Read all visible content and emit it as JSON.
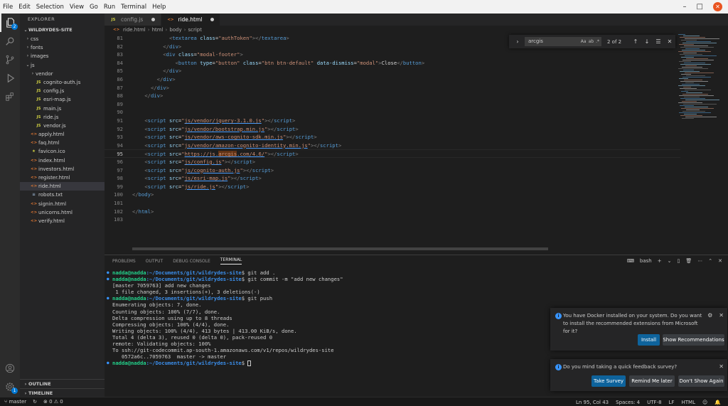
{
  "menu": [
    "File",
    "Edit",
    "Selection",
    "View",
    "Go",
    "Run",
    "Terminal",
    "Help"
  ],
  "window_controls": {
    "minimize": "–",
    "maximize": "□",
    "close": "✕"
  },
  "activity": {
    "explorer_badge": "2",
    "accounts": "account",
    "settings_badge": "1"
  },
  "sidebar": {
    "title": "EXPLORER",
    "root": "WILDRYDES-SITE",
    "items": [
      {
        "label": "css",
        "type": "folder",
        "indent": 1,
        "chevron": "›"
      },
      {
        "label": "fonts",
        "type": "folder",
        "indent": 1,
        "chevron": "›"
      },
      {
        "label": "images",
        "type": "folder",
        "indent": 1,
        "chevron": "›"
      },
      {
        "label": "js",
        "type": "folder",
        "indent": 1,
        "chevron": "⌄"
      },
      {
        "label": "vendor",
        "type": "folder",
        "indent": 2,
        "chevron": "›"
      },
      {
        "label": "cognito-auth.js",
        "type": "js",
        "indent": 2
      },
      {
        "label": "config.js",
        "type": "js",
        "indent": 2
      },
      {
        "label": "esri-map.js",
        "type": "js",
        "indent": 2
      },
      {
        "label": "main.js",
        "type": "js",
        "indent": 2
      },
      {
        "label": "ride.js",
        "type": "js",
        "indent": 2
      },
      {
        "label": "vendor.js",
        "type": "js",
        "indent": 2
      },
      {
        "label": "apply.html",
        "type": "html",
        "indent": 1
      },
      {
        "label": "faq.html",
        "type": "html",
        "indent": 1
      },
      {
        "label": "favicon.ico",
        "type": "ico",
        "indent": 1
      },
      {
        "label": "index.html",
        "type": "html",
        "indent": 1
      },
      {
        "label": "investors.html",
        "type": "html",
        "indent": 1
      },
      {
        "label": "register.html",
        "type": "html",
        "indent": 1
      },
      {
        "label": "ride.html",
        "type": "html",
        "indent": 1,
        "selected": true
      },
      {
        "label": "robots.txt",
        "type": "txt",
        "indent": 1
      },
      {
        "label": "signin.html",
        "type": "html",
        "indent": 1
      },
      {
        "label": "unicorns.html",
        "type": "html",
        "indent": 1
      },
      {
        "label": "verify.html",
        "type": "html",
        "indent": 1
      }
    ],
    "outline": "OUTLINE",
    "timeline": "TIMELINE"
  },
  "tabs": [
    {
      "label": "config.js",
      "icon": "JS",
      "active": false
    },
    {
      "label": "ride.html",
      "icon": "<>",
      "active": true
    }
  ],
  "breadcrumb": [
    "ride.html",
    "html",
    "body",
    "script"
  ],
  "editor": {
    "current_line": 95,
    "lines": [
      {
        "n": "81",
        "html": "            <span class=\"p\">&lt;</span><span class=\"t\">textarea</span> <span class=\"a\">class</span>=<span class=\"s\">\"authToken\"</span><span class=\"p\">&gt;&lt;/</span><span class=\"t\">textarea</span><span class=\"p\">&gt;</span>"
      },
      {
        "n": "82",
        "html": "          <span class=\"p\">&lt;/</span><span class=\"t\">div</span><span class=\"p\">&gt;</span>"
      },
      {
        "n": "83",
        "html": "          <span class=\"p\">&lt;</span><span class=\"t\">div</span> <span class=\"a\">class</span>=<span class=\"s\">\"modal-footer\"</span><span class=\"p\">&gt;</span>"
      },
      {
        "n": "84",
        "html": "              <span class=\"p\">&lt;</span><span class=\"t\">button</span> <span class=\"a\">type</span>=<span class=\"s\">\"button\"</span> <span class=\"a\">class</span>=<span class=\"s\">\"btn btn-default\"</span> <span class=\"a\">data-dismiss</span>=<span class=\"s\">\"modal\"</span><span class=\"p\">&gt;</span><span class=\"x\">Close</span><span class=\"p\">&lt;/</span><span class=\"t\">button</span><span class=\"p\">&gt;</span>"
      },
      {
        "n": "85",
        "html": "          <span class=\"p\">&lt;/</span><span class=\"t\">div</span><span class=\"p\">&gt;</span>"
      },
      {
        "n": "86",
        "html": "        <span class=\"p\">&lt;/</span><span class=\"t\">div</span><span class=\"p\">&gt;</span>"
      },
      {
        "n": "87",
        "html": "      <span class=\"p\">&lt;/</span><span class=\"t\">div</span><span class=\"p\">&gt;</span>"
      },
      {
        "n": "88",
        "html": "    <span class=\"p\">&lt;/</span><span class=\"t\">div</span><span class=\"p\">&gt;</span>"
      },
      {
        "n": "89",
        "html": ""
      },
      {
        "n": "90",
        "html": ""
      },
      {
        "n": "91",
        "html": "    <span class=\"p\">&lt;</span><span class=\"t\">script</span> <span class=\"a\">src</span>=<span class=\"s\">\"<span class=\"u\">js/vendor/jquery-3.1.0.js</span>\"</span><span class=\"p\">&gt;&lt;/</span><span class=\"t\">script</span><span class=\"p\">&gt;</span>"
      },
      {
        "n": "92",
        "html": "    <span class=\"p\">&lt;</span><span class=\"t\">script</span> <span class=\"a\">src</span>=<span class=\"s\">\"<span class=\"u\">js/vendor/bootstrap.min.js</span>\"</span><span class=\"p\">&gt;&lt;/</span><span class=\"t\">script</span><span class=\"p\">&gt;</span>"
      },
      {
        "n": "93",
        "html": "    <span class=\"p\">&lt;</span><span class=\"t\">script</span> <span class=\"a\">src</span>=<span class=\"s\">\"<span class=\"u\">js/vendor/aws-cognito-sdk.min.js</span>\"</span><span class=\"p\">&gt;&lt;/</span><span class=\"t\">script</span><span class=\"p\">&gt;</span>"
      },
      {
        "n": "94",
        "html": "    <span class=\"p\">&lt;</span><span class=\"t\">script</span> <span class=\"a\">src</span>=<span class=\"s\">\"<span class=\"u\">js/vendor/amazon-cognito-identity.min.js</span>\"</span><span class=\"p\">&gt;&lt;/</span><span class=\"t\">script</span><span class=\"p\">&gt;</span>"
      },
      {
        "n": "95",
        "html": "    <span class=\"p\">&lt;</span><span class=\"t\">script</span> <span class=\"a\">src</span>=<span class=\"s\">\"<span class=\"u\">https://js.<span class=\"hl\">arcgis</span>.com/4.6/</span>\"</span><span class=\"p\">&gt;&lt;/</span><span class=\"t\">script</span><span class=\"p\">&gt;</span>"
      },
      {
        "n": "96",
        "html": "    <span class=\"p\">&lt;</span><span class=\"t\">script</span> <span class=\"a\">src</span>=<span class=\"s\">\"<span class=\"u\">js/config.js</span>\"</span><span class=\"p\">&gt;&lt;/</span><span class=\"t\">script</span><span class=\"p\">&gt;</span>"
      },
      {
        "n": "97",
        "html": "    <span class=\"p\">&lt;</span><span class=\"t\">script</span> <span class=\"a\">src</span>=<span class=\"s\">\"<span class=\"u\">js/cognito-auth.js</span>\"</span><span class=\"p\">&gt;&lt;/</span><span class=\"t\">script</span><span class=\"p\">&gt;</span>"
      },
      {
        "n": "98",
        "html": "    <span class=\"p\">&lt;</span><span class=\"t\">script</span> <span class=\"a\">src</span>=<span class=\"s\">\"<span class=\"u\">js/esri-map.js</span>\"</span><span class=\"p\">&gt;&lt;/</span><span class=\"t\">script</span><span class=\"p\">&gt;</span>"
      },
      {
        "n": "99",
        "html": "    <span class=\"p\">&lt;</span><span class=\"t\">script</span> <span class=\"a\">src</span>=<span class=\"s\">\"<span class=\"u\">js/ride.js</span>\"</span><span class=\"p\">&gt;&lt;/</span><span class=\"t\">script</span><span class=\"p\">&gt;</span>"
      },
      {
        "n": "100",
        "html": "<span class=\"p\">&lt;/</span><span class=\"t\">body</span><span class=\"p\">&gt;</span>"
      },
      {
        "n": "101",
        "html": ""
      },
      {
        "n": "102",
        "html": "<span class=\"p\">&lt;/</span><span class=\"t\">html</span><span class=\"p\">&gt;</span>"
      },
      {
        "n": "103",
        "html": ""
      }
    ]
  },
  "find": {
    "value": "arcgis",
    "options": [
      "Aa",
      "ab",
      ".*"
    ],
    "count": "2 of 2",
    "buttons": [
      "↑",
      "↓",
      "☰",
      "✕"
    ]
  },
  "panel": {
    "tabs": [
      "PROBLEMS",
      "OUTPUT",
      "DEBUG CONSOLE",
      "TERMINAL"
    ],
    "active_tab": "TERMINAL",
    "shell": "bash",
    "tools": [
      "+",
      "⌄",
      "▯",
      "🗑",
      "⋯",
      "⌃",
      "✕"
    ],
    "terminal": [
      {
        "bullet": true,
        "user": "nadda@nadda",
        "path": ":~/Documents/git/wildrydes-site",
        "cmd": "$ git add ."
      },
      {
        "bullet": true,
        "user": "nadda@nadda",
        "path": ":~/Documents/git/wildrydes-site",
        "cmd": "$ git commit -m \"add new changes\""
      },
      {
        "text": "[master 7059763] add new changes"
      },
      {
        "text": " 1 file changed, 3 insertions(+), 3 deletions(-)"
      },
      {
        "bullet": true,
        "user": "nadda@nadda",
        "path": ":~/Documents/git/wildrydes-site",
        "cmd": "$ git push"
      },
      {
        "text": "Enumerating objects: 7, done."
      },
      {
        "text": "Counting objects: 100% (7/7), done."
      },
      {
        "text": "Delta compression using up to 8 threads"
      },
      {
        "text": "Compressing objects: 100% (4/4), done."
      },
      {
        "text": "Writing objects: 100% (4/4), 413 bytes | 413.00 KiB/s, done."
      },
      {
        "text": "Total 4 (delta 3), reused 0 (delta 0), pack-reused 0"
      },
      {
        "text": "remote: Validating objects: 100%"
      },
      {
        "text": "To ssh://git-codecommit.ap-south-1.amazonaws.com/v1/repos/wildrydes-site"
      },
      {
        "text": "   0572a6c..7059763  master -> master"
      },
      {
        "bullet": true,
        "user": "nadda@nadda",
        "path": ":~/Documents/git/wildrydes-site",
        "cmd": "$ ",
        "cursor": true
      }
    ]
  },
  "notifications": {
    "docker": {
      "message": "You have Docker installed on your system. Do you want to install the recommended extensions from Microsoft for it?",
      "primary": "Install",
      "secondary": "Show Recommendations"
    },
    "survey": {
      "message": "Do you mind taking a quick feedback survey?",
      "primary": "Take Survey",
      "secondary": "Remind Me later",
      "tertiary": "Don't Show Again"
    }
  },
  "status": {
    "branch": "master",
    "sync": "↻",
    "problems": "⊗ 0 ⚠ 0",
    "position": "Ln 95, Col 43",
    "spaces": "Spaces: 4",
    "encoding": "UTF-8",
    "eol": "LF",
    "language": "HTML",
    "feedback": "☺",
    "bell": "🔔"
  }
}
